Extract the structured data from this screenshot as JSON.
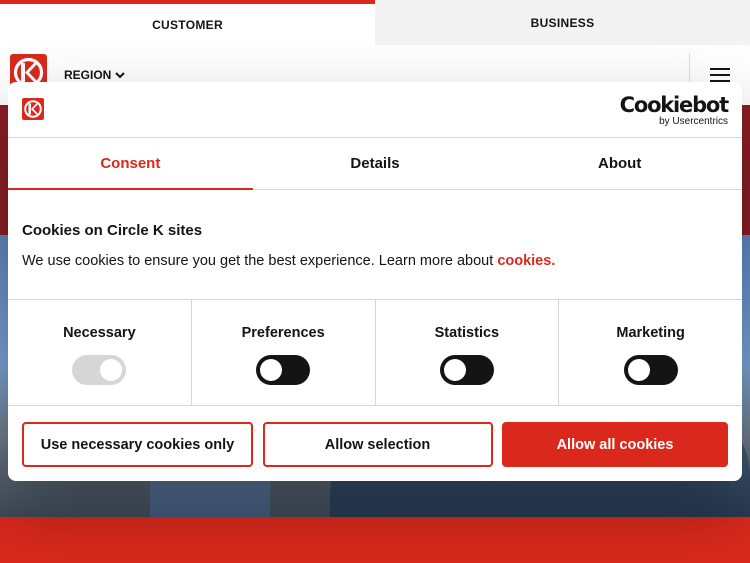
{
  "audience_tabs": [
    {
      "label": "CUSTOMER",
      "active": true
    },
    {
      "label": "BUSINESS",
      "active": false
    }
  ],
  "header": {
    "logo_icon": "circle-k-logo-icon",
    "region_label": "REGION",
    "region_icon": "chevron-down-icon",
    "menu_icon": "hamburger-menu-icon"
  },
  "dialog": {
    "brand": {
      "name": "Cookiebot",
      "by": "by Usercentrics"
    },
    "tabs": [
      {
        "label": "Consent",
        "active": true
      },
      {
        "label": "Details",
        "active": false
      },
      {
        "label": "About",
        "active": false
      }
    ],
    "title": "Cookies on Circle K sites",
    "text": "We use cookies to ensure you get the best experience. Learn more about ",
    "link": "cookies.",
    "toggles": [
      {
        "label": "Necessary",
        "enabled": true,
        "disabled": true
      },
      {
        "label": "Preferences",
        "enabled": false,
        "disabled": false
      },
      {
        "label": "Statistics",
        "enabled": false,
        "disabled": false
      },
      {
        "label": "Marketing",
        "enabled": false,
        "disabled": false
      }
    ],
    "buttons": {
      "necessary_only": "Use necessary cookies only",
      "allow_selection": "Allow selection",
      "allow_all": "Allow all cookies"
    }
  },
  "colors": {
    "brand_red": "#da291c",
    "text": "#141414",
    "divider": "#d6d6d6"
  }
}
